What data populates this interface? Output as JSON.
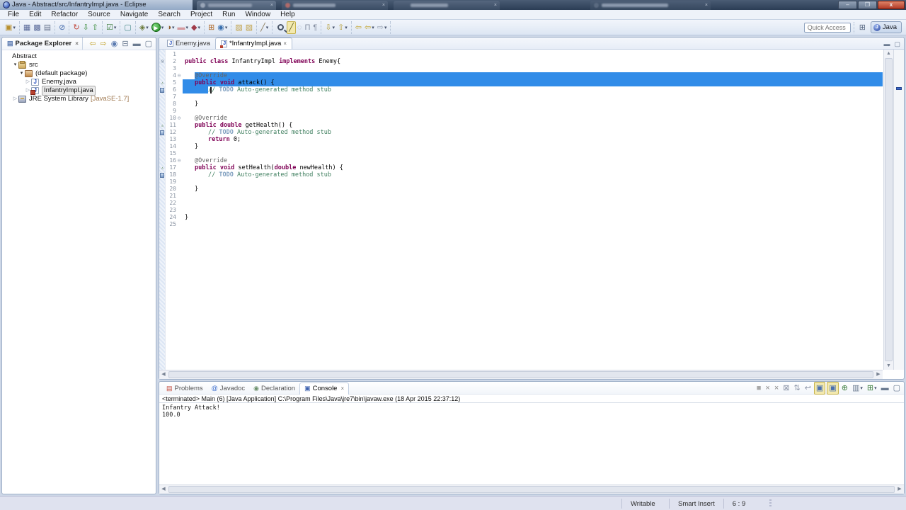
{
  "window": {
    "title": "Java - Abstract/src/InfantryImpl.java - Eclipse",
    "controls": [
      {
        "name": "minimize",
        "glyph": "–"
      },
      {
        "name": "restore",
        "glyph": "❐"
      },
      {
        "name": "close",
        "glyph": "x"
      }
    ]
  },
  "menu_bar": [
    "File",
    "Edit",
    "Refactor",
    "Source",
    "Navigate",
    "Search",
    "Project",
    "Run",
    "Window",
    "Help"
  ],
  "toolbar": {
    "quick_access_placeholder": "Quick Access",
    "perspective_label": "Java",
    "groups": [
      {
        "icons": [
          {
            "name": "new-wizard",
            "g": "▣",
            "c": "#b8902f",
            "dd": true
          }
        ]
      },
      {
        "icons": [
          {
            "name": "save",
            "g": "▦",
            "c": "#5b6b9a"
          },
          {
            "name": "save-all",
            "g": "▩",
            "c": "#5b6b9a"
          },
          {
            "name": "print",
            "g": "▤",
            "c": "#6b7890"
          }
        ]
      },
      {
        "icons": [
          {
            "name": "skip-all-breakpoints",
            "g": "⊘",
            "c": "#4a6fae"
          }
        ]
      },
      {
        "icons": [
          {
            "name": "refresh",
            "g": "↻",
            "c": "#c2473a"
          },
          {
            "name": "import",
            "g": "⇩",
            "c": "#3f8f3f"
          },
          {
            "name": "export",
            "g": "⇧",
            "c": "#3f8f3f"
          }
        ]
      },
      {
        "icons": [
          {
            "name": "verify-tasks",
            "g": "☑",
            "c": "#3f7f3f",
            "dd": true
          }
        ]
      },
      {
        "icons": [
          {
            "name": "new-launch-config",
            "g": "▢",
            "c": "#4a8a8a"
          }
        ]
      },
      {
        "icons": [
          {
            "name": "debug",
            "g": "◈",
            "c": "#6a7a3a",
            "dd": true
          },
          {
            "name": "run",
            "g": "▶",
            "c": "#ffffff",
            "dd": true,
            "css": "run"
          },
          {
            "name": "coverage",
            "g": "◑",
            "c": "#8a5a2a",
            "dd": true
          },
          {
            "name": "profile",
            "g": "▬",
            "c": "#d49aa0",
            "dd": true
          },
          {
            "name": "debug-as",
            "g": "◆",
            "c": "#a03a4a",
            "dd": true
          }
        ]
      },
      {
        "icons": [
          {
            "name": "new-junit-test",
            "g": "⊞",
            "c": "#b06a2a"
          },
          {
            "name": "open-type",
            "g": "◉",
            "c": "#3a6fae",
            "dd": true
          }
        ]
      },
      {
        "icons": [
          {
            "name": "open-resource",
            "g": "▨",
            "c": "#c2a24a"
          },
          {
            "name": "open-file",
            "g": "▨",
            "c": "#c2a24a"
          }
        ]
      },
      {
        "icons": [
          {
            "name": "annotate",
            "g": "╱",
            "c": "#8a7a5a",
            "dd": true
          }
        ]
      },
      {
        "icons": [
          {
            "name": "search",
            "g": "",
            "c": "#444444",
            "css": "search"
          },
          {
            "name": "mark-occurrences",
            "g": "╱",
            "c": "#6a6a2a",
            "pressed": true
          },
          {
            "name": "show-annotations",
            "g": "◌",
            "c": "#99a5b5"
          },
          {
            "name": "show-whitespace",
            "g": "Π",
            "c": "#8a93a6"
          },
          {
            "name": "block-selection",
            "g": "¶",
            "c": "#8a93a6"
          }
        ]
      },
      {
        "icons": [
          {
            "name": "next-annotation",
            "g": "⇩",
            "c": "#b8a03a",
            "dd": true
          },
          {
            "name": "previous-annotation",
            "g": "⇧",
            "c": "#b8a03a",
            "dd": true
          }
        ]
      },
      {
        "icons": [
          {
            "name": "last-edit-location",
            "g": "⇦",
            "c": "#c2a22a"
          },
          {
            "name": "back",
            "g": "⇦",
            "c": "#c2a22a",
            "dd": true
          },
          {
            "name": "forward",
            "g": "⇨",
            "c": "#9aa4b4",
            "dd": true
          }
        ]
      }
    ]
  },
  "package_explorer": {
    "title": "Package Explorer",
    "toolbar": [
      {
        "name": "back",
        "g": "⇦",
        "c": "#c2a22a"
      },
      {
        "name": "forward",
        "g": "⇨",
        "c": "#c2a22a"
      },
      {
        "name": "link-with-editor",
        "g": "◉",
        "c": "#5a7ab0"
      },
      {
        "name": "collapse-all",
        "g": "⊟",
        "c": "#6a7a90"
      },
      {
        "name": "minimize",
        "g": "▬",
        "c": "#6a7a90"
      },
      {
        "name": "maximize",
        "g": "▢",
        "c": "#6a7a90"
      }
    ],
    "tree": [
      {
        "label": "Abstract",
        "level": 0,
        "icon": "none",
        "arrow": "none"
      },
      {
        "label": "src",
        "level": 1,
        "icon": "package-folder",
        "arrow": "expanded"
      },
      {
        "label": "(default package)",
        "level": 2,
        "icon": "package",
        "arrow": "expanded"
      },
      {
        "label": "Enemy.java",
        "level": 3,
        "icon": "java-file",
        "arrow": "collapsed"
      },
      {
        "label": "InfantryImpl.java",
        "level": 3,
        "icon": "java-file",
        "modified": true,
        "arrow": "collapsed",
        "selected": true
      },
      {
        "label": "JRE System Library",
        "suffix": "[JavaSE-1.7]",
        "level": 1,
        "icon": "library",
        "arrow": "collapsed"
      }
    ]
  },
  "editor": {
    "tabs": [
      {
        "label": "Enemy.java",
        "active": false,
        "modified": false
      },
      {
        "label": "*InfantryImpl.java",
        "active": true,
        "modified": true,
        "closable": true
      }
    ],
    "lines": [
      {
        "n": 1,
        "ind": 0,
        "segs": []
      },
      {
        "n": 2,
        "ind": 0,
        "marker": "type",
        "segs": [
          {
            "c": "kw",
            "t": "public class "
          },
          {
            "c": "pl",
            "t": "InfantryImpl "
          },
          {
            "c": "kw",
            "t": "implements "
          },
          {
            "c": "pl",
            "t": "Enemy{"
          }
        ]
      },
      {
        "n": 3,
        "ind": 0,
        "segs": []
      },
      {
        "n": 4,
        "ind": 14,
        "fold": true,
        "sel": {
          "l": 18,
          "r": 0
        },
        "segs": [
          {
            "c": "an",
            "t": "@Override"
          }
        ]
      },
      {
        "n": 5,
        "ind": 14,
        "marker": "override",
        "sel": {
          "l": 1,
          "r": 0
        },
        "segs": [
          {
            "c": "kw",
            "t": "public void "
          },
          {
            "c": "pl",
            "t": "attack() {"
          }
        ]
      },
      {
        "n": 6,
        "ind": 33,
        "marker": "task",
        "sel": {
          "l": 1,
          "w": 36
        },
        "caret": 36,
        "segs": [
          {
            "c": "cm",
            "t": "// "
          },
          {
            "c": "td",
            "t": "TODO"
          },
          {
            "c": "cm",
            "t": " Auto-generated method stub"
          }
        ]
      },
      {
        "n": 7,
        "ind": 0,
        "segs": []
      },
      {
        "n": 8,
        "ind": 14,
        "segs": [
          {
            "c": "pl",
            "t": "}"
          }
        ]
      },
      {
        "n": 9,
        "ind": 0,
        "segs": []
      },
      {
        "n": 10,
        "ind": 14,
        "fold": true,
        "segs": [
          {
            "c": "an",
            "t": "@Override"
          }
        ]
      },
      {
        "n": 11,
        "ind": 14,
        "marker": "override",
        "segs": [
          {
            "c": "kw",
            "t": "public double "
          },
          {
            "c": "pl",
            "t": "getHealth() {"
          }
        ]
      },
      {
        "n": 12,
        "ind": 33,
        "marker": "task",
        "segs": [
          {
            "c": "cm",
            "t": "// "
          },
          {
            "c": "td",
            "t": "TODO"
          },
          {
            "c": "cm",
            "t": " Auto-generated method stub"
          }
        ]
      },
      {
        "n": 13,
        "ind": 33,
        "segs": [
          {
            "c": "kw",
            "t": "return "
          },
          {
            "c": "pl",
            "t": "0;"
          }
        ]
      },
      {
        "n": 14,
        "ind": 14,
        "segs": [
          {
            "c": "pl",
            "t": "}"
          }
        ]
      },
      {
        "n": 15,
        "ind": 0,
        "segs": []
      },
      {
        "n": 16,
        "ind": 14,
        "fold": true,
        "segs": [
          {
            "c": "an",
            "t": "@Override"
          }
        ]
      },
      {
        "n": 17,
        "ind": 14,
        "marker": "override",
        "segs": [
          {
            "c": "kw",
            "t": "public void "
          },
          {
            "c": "pl",
            "t": "setHealth("
          },
          {
            "c": "kw",
            "t": "double"
          },
          {
            "c": "pl",
            "t": " newHealth) {"
          }
        ]
      },
      {
        "n": 18,
        "ind": 33,
        "marker": "task",
        "segs": [
          {
            "c": "cm",
            "t": "// "
          },
          {
            "c": "td",
            "t": "TODO"
          },
          {
            "c": "cm",
            "t": " Auto-generated method stub"
          }
        ]
      },
      {
        "n": 19,
        "ind": 0,
        "segs": []
      },
      {
        "n": 20,
        "ind": 14,
        "segs": [
          {
            "c": "pl",
            "t": "}"
          }
        ]
      },
      {
        "n": 21,
        "ind": 0,
        "segs": []
      },
      {
        "n": 22,
        "ind": 0,
        "segs": []
      },
      {
        "n": 23,
        "ind": 0,
        "segs": []
      },
      {
        "n": 24,
        "ind": 0,
        "segs": [
          {
            "c": "pl",
            "t": "}"
          }
        ]
      },
      {
        "n": 25,
        "ind": 0,
        "segs": []
      }
    ]
  },
  "console": {
    "tabs": [
      {
        "label": "Problems",
        "icon": "▤",
        "icon_color": "#c24a3a",
        "active": false
      },
      {
        "label": "Javadoc",
        "icon": "@",
        "icon_color": "#3a6ccc",
        "active": false
      },
      {
        "label": "Declaration",
        "icon": "◉",
        "icon_color": "#6a8f6a",
        "active": false
      },
      {
        "label": "Console",
        "icon": "▣",
        "icon_color": "#3a5fae",
        "active": true,
        "closable": true
      }
    ],
    "toolbar": [
      {
        "name": "terminate",
        "g": "■",
        "c": "#a8a8a8"
      },
      {
        "name": "remove-launch",
        "g": "×",
        "c": "#8a8a8a"
      },
      {
        "name": "remove-all-terminated",
        "g": "×",
        "c": "#8a8a8a"
      },
      {
        "name": "clear-console",
        "g": "⊠",
        "c": "#8a93a6"
      },
      {
        "name": "scroll-lock",
        "g": "⇅",
        "c": "#8a93a6"
      },
      {
        "name": "word-wrap",
        "g": "↩",
        "c": "#8a93a6"
      },
      {
        "name": "show-console-on-stdout",
        "g": "▣",
        "c": "#4a6fae",
        "pressed": true
      },
      {
        "name": "show-console-on-stderr",
        "g": "▣",
        "c": "#4a6fae",
        "pressed": true
      },
      {
        "name": "pin-console",
        "g": "⊕",
        "c": "#3f7f3f"
      },
      {
        "name": "display-selected-console",
        "g": "▥",
        "c": "#6a7a90",
        "dd": true
      },
      {
        "name": "open-console",
        "g": "⊞",
        "c": "#3f7f3f",
        "dd": true
      },
      {
        "name": "minimize-console",
        "g": "▬",
        "c": "#6a7a90"
      },
      {
        "name": "maximize-console",
        "g": "▢",
        "c": "#6a7a90"
      }
    ],
    "status_line": "<terminated> Main (6) [Java Application] C:\\Program Files\\Java\\jre7\\bin\\javaw.exe (18 Apr 2015 22:37:12)",
    "output": [
      "Infantry Attack!",
      "100.0"
    ]
  },
  "status_bar": {
    "writable": "Writable",
    "insert_mode": "Smart Insert",
    "cursor_position": "6 : 9"
  }
}
